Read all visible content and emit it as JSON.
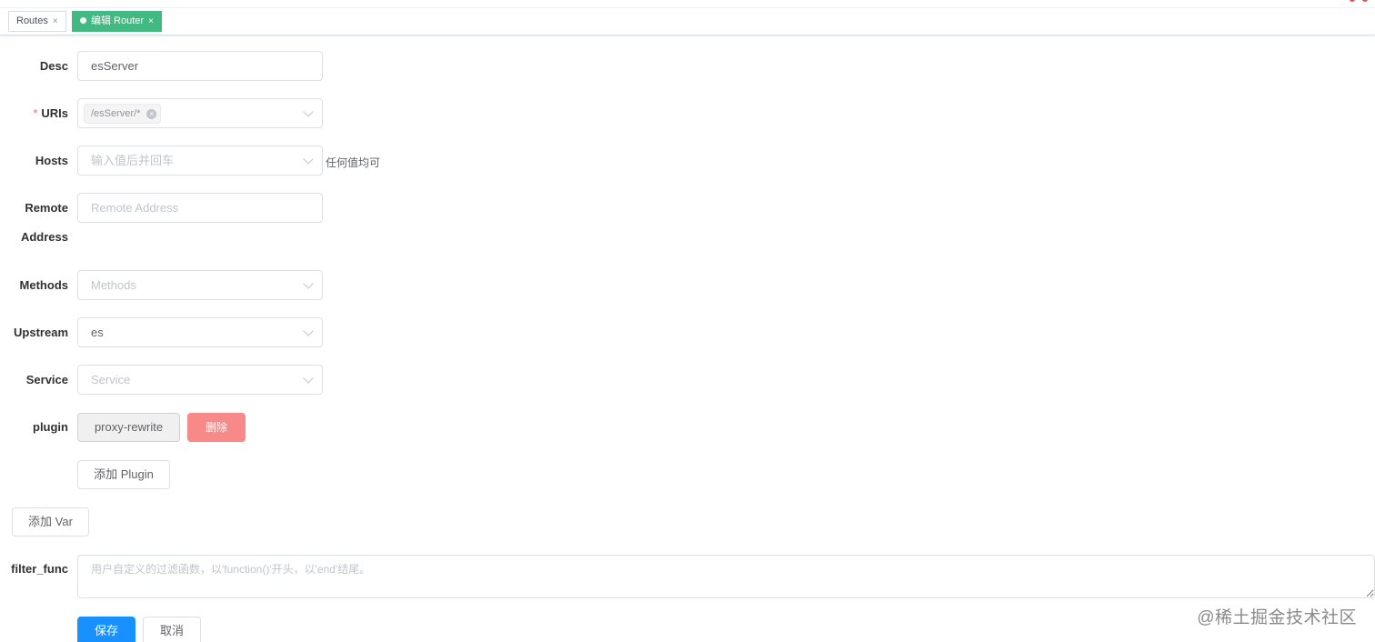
{
  "tabs": [
    {
      "label": "Routes",
      "close": "×"
    },
    {
      "label": "编辑 Router",
      "close": "×"
    }
  ],
  "form": {
    "desc": {
      "label": "Desc",
      "value": "esServer"
    },
    "uris": {
      "label": "URIs",
      "required_mark": "*",
      "tags": [
        "/esServer/*"
      ],
      "tag_close": "×"
    },
    "hosts": {
      "label": "Hosts",
      "placeholder": "输入值后并回车",
      "hint": "任何值均可"
    },
    "remote_address": {
      "label_line1": "Remote",
      "label_line2": "Address",
      "placeholder": "Remote Address"
    },
    "methods": {
      "label": "Methods",
      "placeholder": "Methods"
    },
    "upstream": {
      "label": "Upstream",
      "value": "es"
    },
    "service": {
      "label": "Service",
      "placeholder": "Service"
    },
    "plugin": {
      "label": "plugin",
      "name": "proxy-rewrite",
      "delete_label": "删除",
      "add_label": "添加 Plugin"
    },
    "add_var_label": "添加 Var",
    "filter_func": {
      "label": "filter_func",
      "placeholder": "用户自定义的过滤函数，以'function()'开头，以'end'结尾。"
    },
    "save_label": "保存",
    "cancel_label": "取消"
  },
  "watermark": "@稀土掘金技术社区",
  "colors": {
    "tab_active": "#42b983",
    "primary": "#1890ff",
    "danger": "#f78989",
    "required": "#f56c6c"
  }
}
